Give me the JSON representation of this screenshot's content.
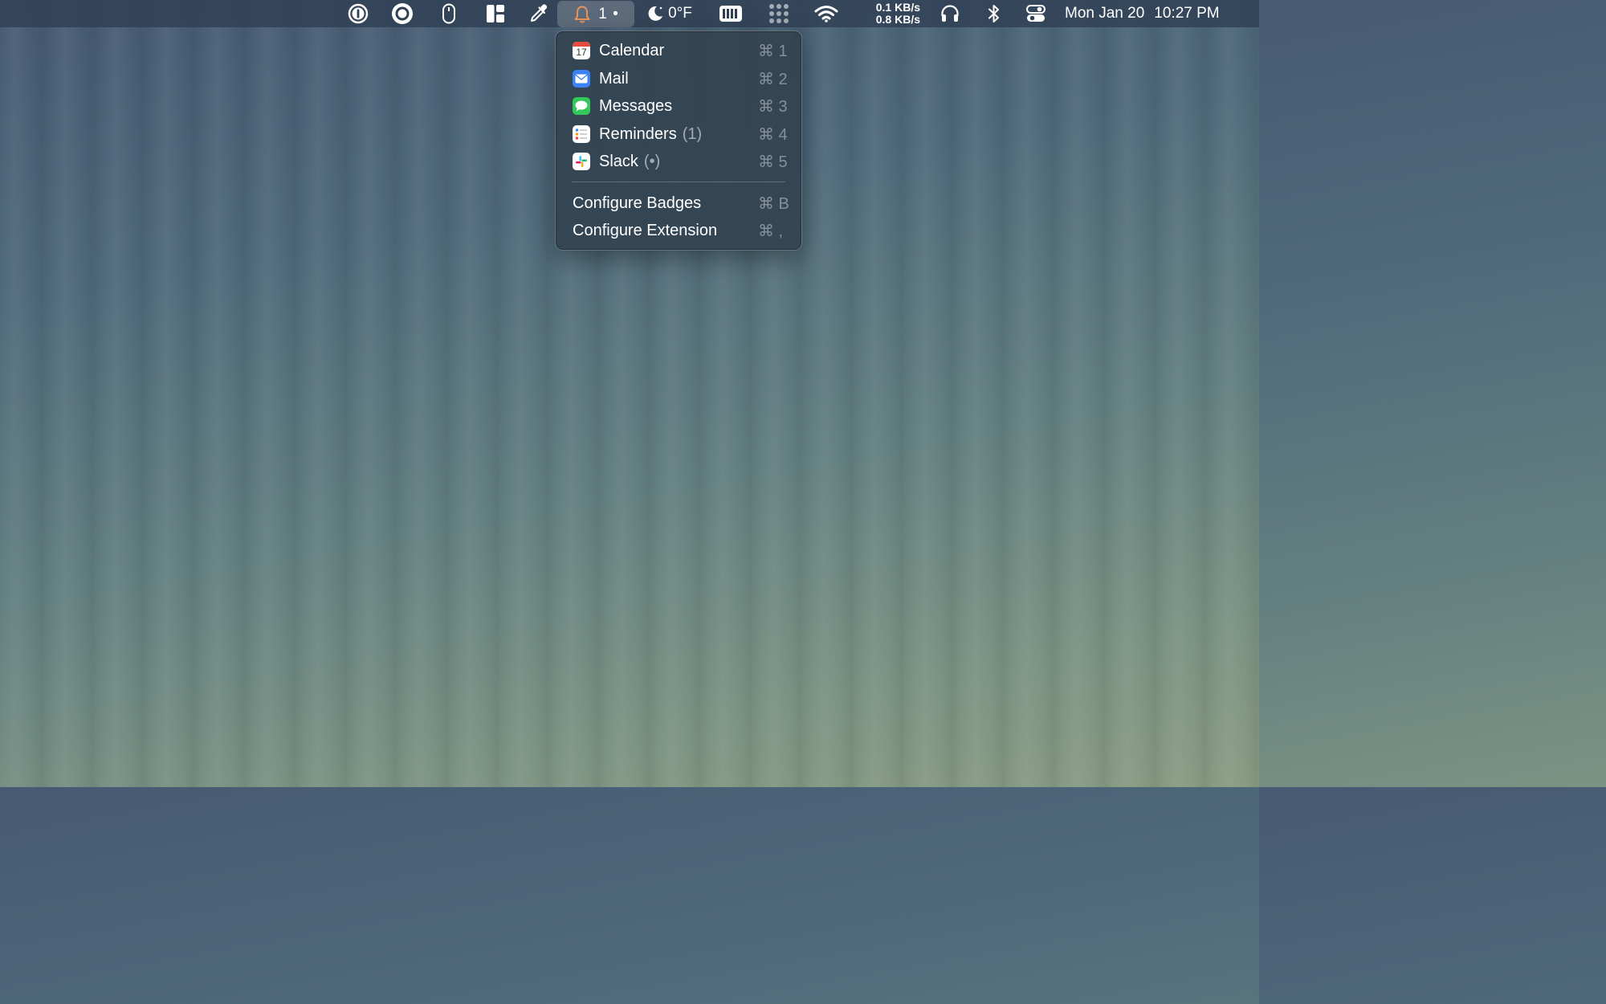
{
  "menubar": {
    "notifications": {
      "count": "1 •"
    },
    "weather": {
      "temperature": "0°F"
    },
    "network": {
      "upload": "0.1 KB/s",
      "download": "0.8 KB/s"
    },
    "clock": {
      "date": "Mon Jan 20",
      "time": "10:27 PM"
    },
    "icons": [
      "1password-icon",
      "record-icon",
      "mouse-icon",
      "window-layout-icon",
      "color-picker-icon",
      "bell-icon",
      "moon-icon",
      "battery-icon",
      "app-grid-icon",
      "wifi-icon",
      "headphones-icon",
      "bluetooth-icon",
      "control-center-icon"
    ]
  },
  "menu": {
    "items": [
      {
        "label": "Calendar",
        "badge": "",
        "shortcut": "⌘ 1",
        "icon": "calendar-icon",
        "icon_text": "17"
      },
      {
        "label": "Mail",
        "badge": "",
        "shortcut": "⌘ 2",
        "icon": "mail-icon"
      },
      {
        "label": "Messages",
        "badge": "",
        "shortcut": "⌘ 3",
        "icon": "messages-icon"
      },
      {
        "label": "Reminders",
        "badge": "(1)",
        "shortcut": "⌘ 4",
        "icon": "reminders-icon"
      },
      {
        "label": "Slack",
        "badge": "(•)",
        "shortcut": "⌘ 5",
        "icon": "slack-icon"
      }
    ],
    "actions": [
      {
        "label": "Configure Badges",
        "shortcut": "⌘ B"
      },
      {
        "label": "Configure Extension",
        "shortcut": "⌘ ,"
      }
    ]
  },
  "colors": {
    "menubar_bg": "#304054",
    "bell_accent": "#e8945a",
    "calendar_red": "#e34c3f",
    "mail_blue": "#3b82f6",
    "messages_green": "#34c759"
  }
}
